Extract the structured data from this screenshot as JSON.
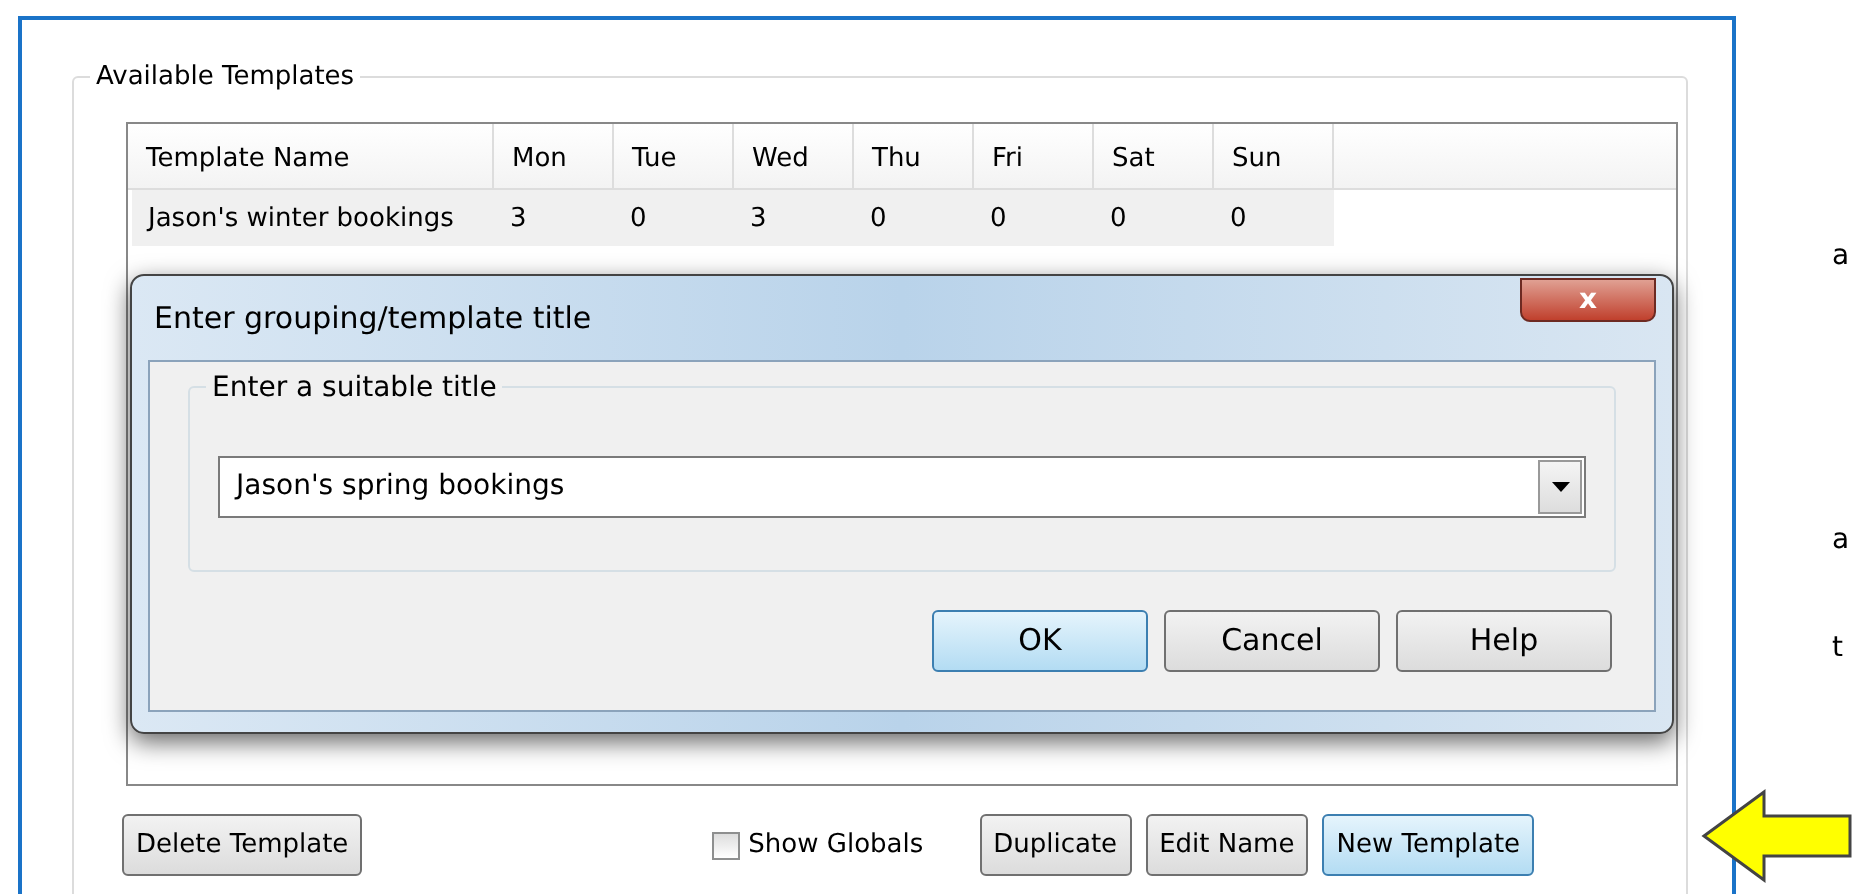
{
  "group": {
    "title": "Available Templates"
  },
  "table": {
    "columns": [
      "Template Name",
      "Mon",
      "Tue",
      "Wed",
      "Thu",
      "Fri",
      "Sat",
      "Sun"
    ],
    "rows": [
      [
        "Jason's winter bookings",
        "3",
        "0",
        "3",
        "0",
        "0",
        "0",
        "0"
      ]
    ]
  },
  "dialog": {
    "title": "Enter grouping/template title",
    "close": "x",
    "group_title": "Enter a suitable title",
    "combo": {
      "value": "Jason's spring bookings"
    },
    "buttons": [
      {
        "label": "OK",
        "default": true
      },
      {
        "label": "Cancel",
        "default": false
      },
      {
        "label": "Help",
        "default": false
      }
    ]
  },
  "footer": {
    "left_buttons": [
      {
        "label": "Delete Template",
        "default": false
      }
    ],
    "show_globals": {
      "label": "Show Globals",
      "checked": false
    },
    "right_buttons": [
      {
        "label": "Duplicate",
        "default": false
      },
      {
        "label": "Edit Name",
        "default": false
      },
      {
        "label": "New Template",
        "default": true
      }
    ]
  },
  "margin_text": [
    "a",
    "a",
    "t"
  ]
}
